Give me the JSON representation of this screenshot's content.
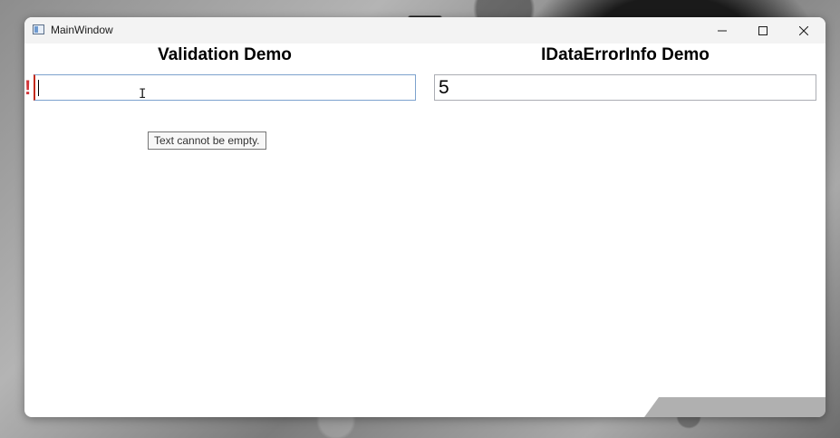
{
  "window": {
    "title": "MainWindow",
    "icons": {
      "app": "app-window-icon",
      "minimize": "minimize-icon",
      "maximize": "maximize-icon",
      "close": "close-icon"
    }
  },
  "validation_demo": {
    "title": "Validation Demo",
    "input_value": "",
    "error_indicator": "!",
    "tooltip": "Text cannot be empty."
  },
  "idataerrorinfo_demo": {
    "title": "IDataErrorInfo Demo",
    "input_value": "5"
  },
  "colors": {
    "error": "#d13438",
    "title_bar": "#f3f3f3",
    "input_border": "#abadb3",
    "focus_border": "#7da2ce"
  }
}
